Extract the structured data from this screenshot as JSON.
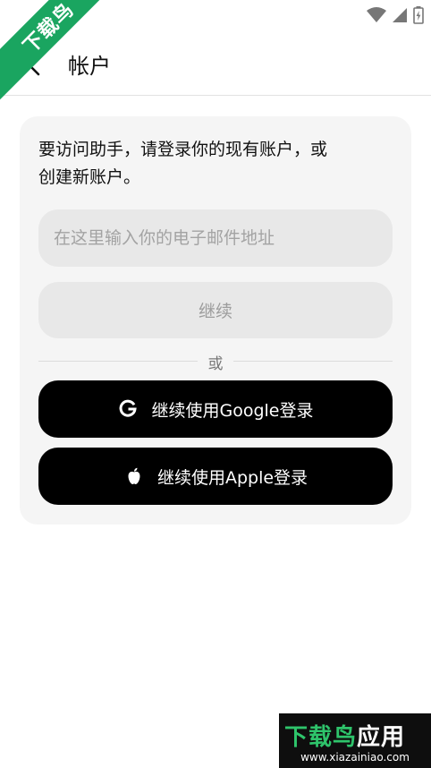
{
  "corner_badge": "下载鸟",
  "header": {
    "title": "帐户"
  },
  "card": {
    "intro_line1": "要访问助手，请登录你的现有账户，或",
    "intro_line2": "创建新账户。",
    "email_placeholder": "在这里输入你的电子邮件地址",
    "continue_label": "继续",
    "or_label": "或",
    "google_label": "继续使用Google登录",
    "apple_label": "继续使用Apple登录"
  },
  "watermark": {
    "brand_green": "下载鸟",
    "brand_white": "应用",
    "url": "www.xiazainiao.com"
  },
  "colors": {
    "ribbon": "#1aa560",
    "card_bg": "#f5f5f5",
    "field_bg": "#e8e8e8",
    "primary_button": "#000000"
  },
  "icons": {
    "back": "arrow-left-icon",
    "google": "google-g-icon",
    "apple": "apple-logo-icon",
    "wifi": "wifi-icon",
    "signal": "signal-icon",
    "battery": "battery-icon"
  }
}
